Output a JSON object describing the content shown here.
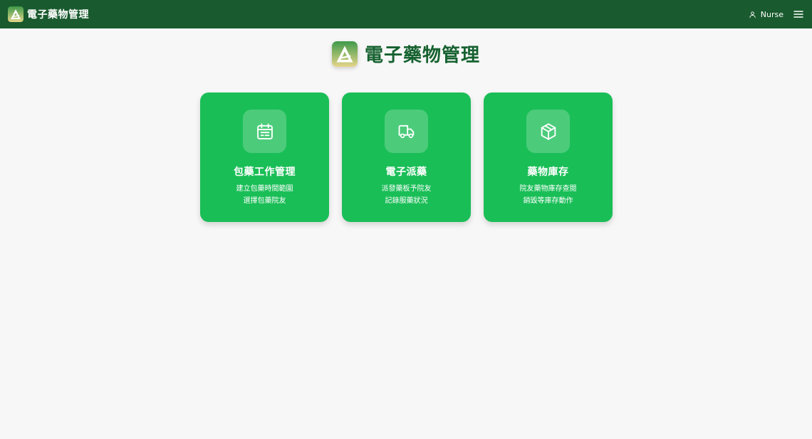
{
  "header": {
    "app_title": "電子藥物管理",
    "user_label": "Nurse",
    "user_icon": "user-icon",
    "menu_icon": "hamburger-menu-icon"
  },
  "hero": {
    "title": "電子藥物管理"
  },
  "cards": [
    {
      "icon": "calendar-list-icon",
      "title": "包藥工作管理",
      "lines": [
        "建立包藥時間範圍",
        "選擇包藥院友"
      ]
    },
    {
      "icon": "truck-icon",
      "title": "電子派藥",
      "lines": [
        "派發藥板予院友",
        "記錄服藥狀況"
      ]
    },
    {
      "icon": "package-box-icon",
      "title": "藥物庫存",
      "lines": [
        "院友藥物庫存查閱",
        "銷毀等庫存動作"
      ]
    }
  ],
  "colors": {
    "header_bg": "#195a2e",
    "card_bg": "#1abe57",
    "title_green": "#15612f",
    "page_bg": "#f7f7f7"
  }
}
